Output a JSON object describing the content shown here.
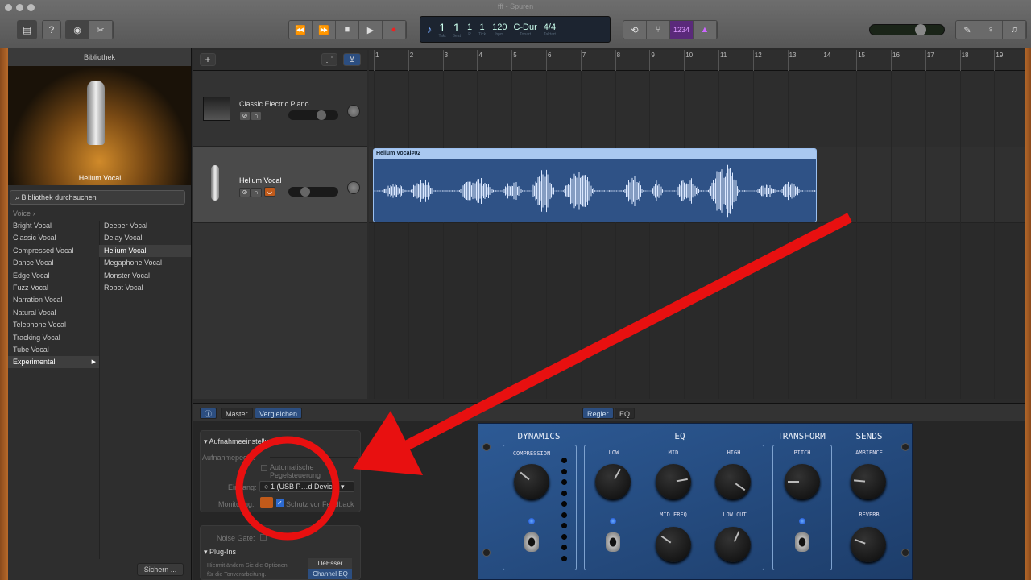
{
  "window": {
    "title": "fff - Spuren"
  },
  "toolbar": {
    "library": "library-icon",
    "help": "?",
    "smart_controls": "knob-icon",
    "editors": "scissors-icon",
    "transport": [
      "⏪",
      "⏩",
      "■",
      "▶",
      "●"
    ],
    "lcd": {
      "takt": "1",
      "takt_label": "Takt",
      "beat": "1",
      "beat_label": "Beat",
      "r": "1",
      "r_label": "R",
      "tick": "1",
      "tick_label": "Tick",
      "bpm": "120",
      "bpm_label": "bpm",
      "key": "C-Dur",
      "key_label": "Tonart",
      "sig": "4/4",
      "sig_label": "Taktart"
    },
    "cycle": "⟲",
    "tuner": "tuner-icon",
    "countin": "1234",
    "metronome": "metronome-icon",
    "master_volume": 0.7
  },
  "library": {
    "header": "Bibliothek",
    "preview_name": "Helium Vocal",
    "search_placeholder": "Bibliothek durchsuchen",
    "breadcrumb": "Voice",
    "col1": [
      "Bright Vocal",
      "Classic Vocal",
      "Compressed Vocal",
      "Dance Vocal",
      "Edge Vocal",
      "Fuzz Vocal",
      "Narration Vocal",
      "Natural Vocal",
      "Telephone Vocal",
      "Tracking Vocal",
      "Tube Vocal",
      "Experimental"
    ],
    "col2": [
      "Deeper Vocal",
      "Delay Vocal",
      "Helium Vocal",
      "Megaphone Vocal",
      "Monster Vocal",
      "Robot Vocal"
    ],
    "save": "Sichern ..."
  },
  "tracks": [
    {
      "name": "Classic Electric Piano",
      "volume": 0.7
    },
    {
      "name": "Helium Vocal",
      "volume": 0.3
    }
  ],
  "ruler": [
    "1",
    "2",
    "3",
    "4",
    "5",
    "6",
    "7",
    "8",
    "9",
    "10",
    "11",
    "12",
    "13",
    "14",
    "15",
    "16",
    "17",
    "18",
    "19"
  ],
  "region": {
    "name": "Helium Vocal#02"
  },
  "bottom": {
    "tabs": [
      "Master",
      "Vergleichen"
    ],
    "center_tabs": [
      "Regler",
      "EQ"
    ],
    "rec": {
      "title": "Aufnahmeeinstellungen",
      "level": "Aufnahmepegel:",
      "auto1": "Automatische",
      "auto2": "Pegelsteuerung",
      "input_label": "Eingang:",
      "input": "1  (USB P…d Device)",
      "monitoring": "Monitoring:",
      "feedback": "Schutz vor Feedback"
    },
    "noise_gate": "Noise Gate:",
    "plugins": "Plug-Ins",
    "plugins_desc1": "Hiermit ändern Sie die Optionen",
    "plugins_desc2": "für die Tonverarbeitung.",
    "plugin_list": [
      "DeEsser",
      "Channel EQ"
    ]
  },
  "controls": {
    "dynamics": "DYNAMICS",
    "eq": "EQ",
    "transform": "TRANSFORM",
    "sends": "SENDS",
    "compression": "COMPRESSION",
    "low": "LOW",
    "mid": "MID",
    "high": "HIGH",
    "mid_freq": "MID FREQ",
    "low_cut": "LOW CUT",
    "pitch": "PITCH",
    "ambience": "AMBIENCE",
    "reverb": "REVERB"
  },
  "annotation_color": "#e81010"
}
